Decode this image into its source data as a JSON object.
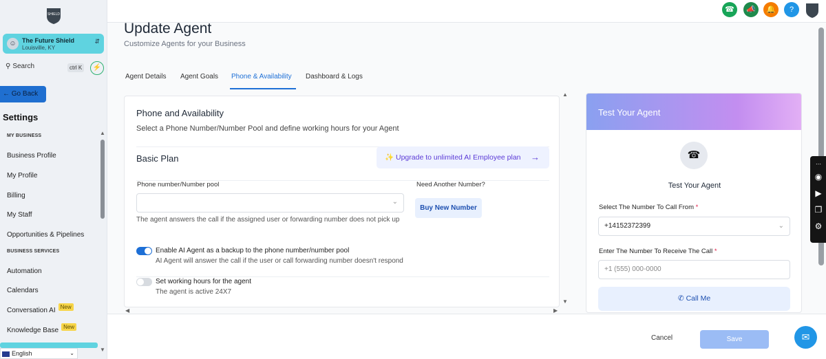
{
  "sidebar": {
    "logo_text": "SHIELD",
    "location": {
      "name": "The Future Shield",
      "city": "Louisville, KY",
      "avatar_icon": "user-icon"
    },
    "search": {
      "label": "Search",
      "shortcut": "ctrl K"
    },
    "go_back": "← Go Back",
    "title": "Settings",
    "sections": [
      {
        "header": "MY BUSINESS",
        "items": [
          "Business Profile",
          "My Profile",
          "Billing",
          "My Staff",
          "Opportunities & Pipelines"
        ]
      },
      {
        "header": "BUSINESS SERVICES",
        "items": [
          "Automation",
          "Calendars",
          "Conversation AI",
          "Knowledge Base"
        ]
      }
    ],
    "new_badge": "New",
    "language": "English"
  },
  "topbar": {
    "icons": [
      {
        "name": "phone-icon",
        "color": "#18a558"
      },
      {
        "name": "megaphone-icon",
        "color": "#1e8a4c"
      },
      {
        "name": "bell-icon",
        "color": "#f57c00"
      },
      {
        "name": "help-icon",
        "color": "#2196e6"
      }
    ]
  },
  "page": {
    "title": "Update Agent",
    "subtitle": "Customize Agents for your Business",
    "tabs": [
      "Agent Details",
      "Agent Goals",
      "Phone & Availability",
      "Dashboard & Logs"
    ],
    "active_tab": "Phone & Availability"
  },
  "availability": {
    "title": "Phone and Availability",
    "subtitle": "Select a Phone Number/Number Pool and define working hours for your Agent",
    "plan": "Basic Plan",
    "upgrade_label": "Upgrade to unlimited AI Employee plan",
    "number_pool_label": "Phone number/Number pool",
    "number_pool_value": "",
    "need_number_label": "Need Another Number?",
    "buy_button": "Buy New Number",
    "helper": "The agent answers the call if the assigned user or forwarding number does not pick up",
    "backup_toggle": {
      "label": "Enable AI Agent as a backup to the phone number/number pool",
      "help": "AI Agent will answer the call if the user or call forwarding number doesn't respond",
      "on": true
    },
    "hours_toggle": {
      "label": "Set working hours for the agent",
      "help": "The agent is active 24X7",
      "on": false
    }
  },
  "test_agent": {
    "header": "Test Your Agent",
    "title": "Test Your Agent",
    "from_label": "Select The Number To Call From",
    "from_value": "+14152372399",
    "to_label": "Enter The Number To Receive The Call",
    "to_placeholder": "+1 (555) 000-0000",
    "call_button": "Call Me",
    "required_mark": "*"
  },
  "footer": {
    "cancel": "Cancel",
    "save": "Save"
  },
  "colors": {
    "accent": "#1d6fd6",
    "sidebar_highlight": "#5fd3e0",
    "toggle_on": "#1d6fd6",
    "toggle_off": "#d7dbe0"
  }
}
